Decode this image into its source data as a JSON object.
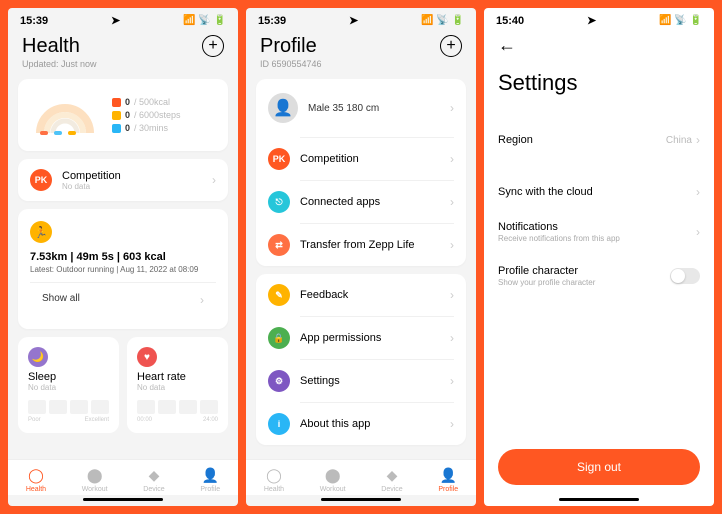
{
  "screen1": {
    "time": "15:39",
    "title": "Health",
    "updated": "Updated: Just now",
    "metrics": {
      "cal_value": "0",
      "cal_goal": "/ 500kcal",
      "steps_value": "0",
      "steps_goal": "/ 6000steps",
      "stand_value": "0",
      "stand_goal": "/ 30mins"
    },
    "competition": {
      "label": "Competition",
      "sub": "No data",
      "pk": "PK"
    },
    "workout": {
      "summary": "7.53km | 49m 5s | 603 kcal",
      "latest": "Latest: Outdoor running | Aug 11, 2022 at 08:09",
      "show_all": "Show all"
    },
    "sleep": {
      "title": "Sleep",
      "sub": "No data",
      "lo": "Poor",
      "hi": "Excellent"
    },
    "heart": {
      "title": "Heart rate",
      "sub": "No data",
      "lo": "00:00",
      "hi": "24:00"
    }
  },
  "screen2": {
    "time": "15:39",
    "title": "Profile",
    "id": "ID 6590554746",
    "bio": "Male 35 180 cm",
    "pk": "PK",
    "rows": {
      "competition": "Competition",
      "connected": "Connected apps",
      "transfer": "Transfer from Zepp Life",
      "feedback": "Feedback",
      "permissions": "App permissions",
      "settings": "Settings",
      "about": "About this app"
    }
  },
  "screen3": {
    "time": "15:40",
    "title": "Settings",
    "region": {
      "label": "Region",
      "value": "China"
    },
    "sync": "Sync with the cloud",
    "notifications": {
      "label": "Notifications",
      "sub": "Receive notifications from this app"
    },
    "profile_char": {
      "label": "Profile character",
      "sub": "Show your profile character"
    },
    "signout": "Sign out"
  },
  "nav": {
    "health": "Health",
    "workout": "Workout",
    "device": "Device",
    "profile": "Profile"
  }
}
